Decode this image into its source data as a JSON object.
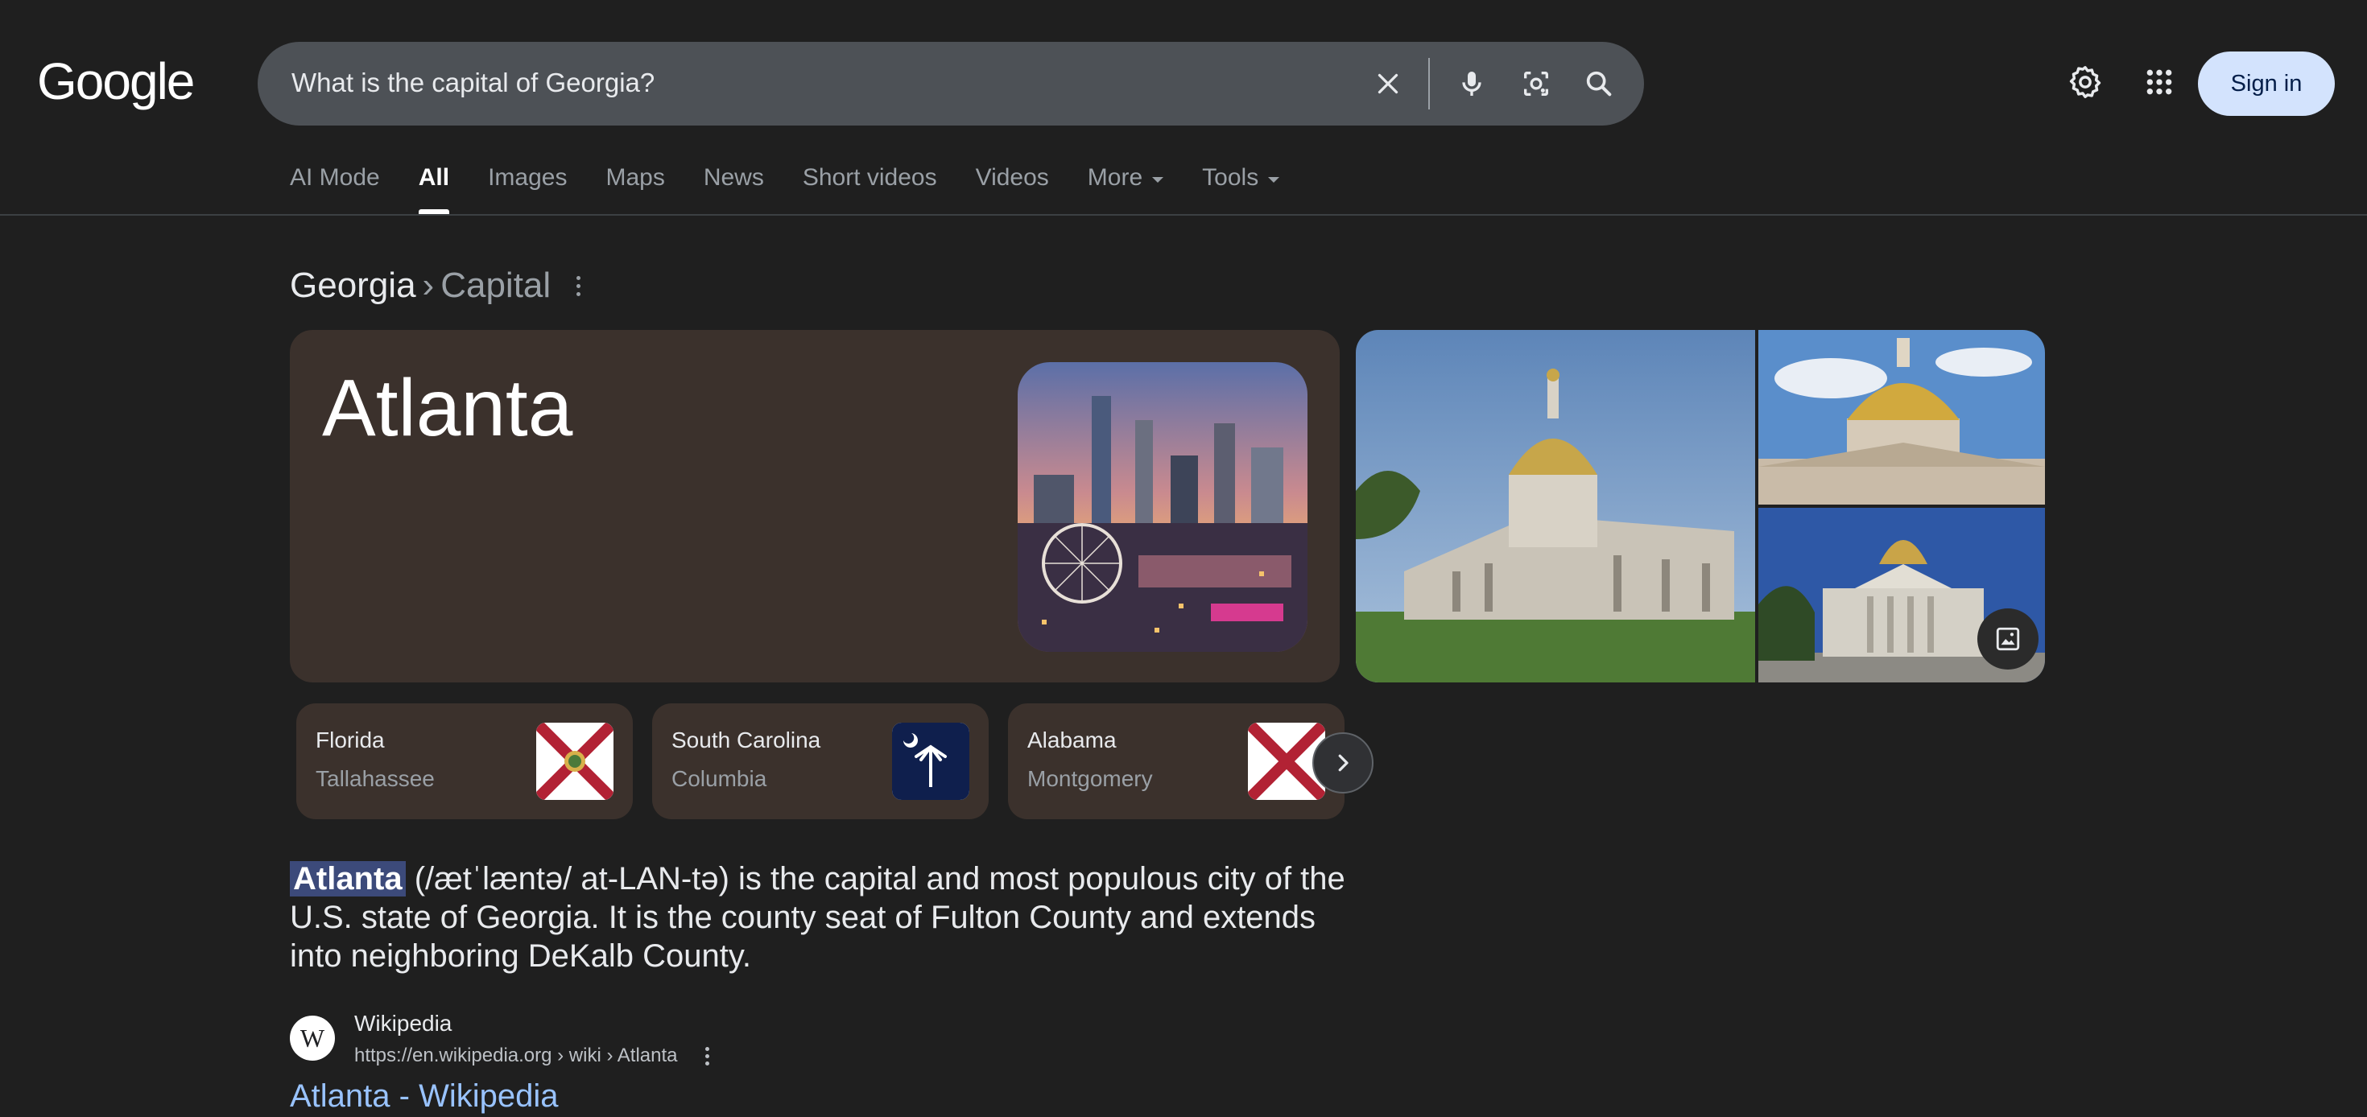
{
  "header": {
    "logo_text": "Google",
    "search_value": "What is the capital of Georgia?",
    "sign_in_label": "Sign in",
    "icons": [
      "close-icon",
      "microphone-icon",
      "lens-icon",
      "search-icon",
      "settings-icon",
      "apps-grid-icon"
    ]
  },
  "tabs": [
    {
      "label": "AI Mode"
    },
    {
      "label": "All",
      "active": true
    },
    {
      "label": "Images"
    },
    {
      "label": "Maps"
    },
    {
      "label": "News"
    },
    {
      "label": "Short videos"
    },
    {
      "label": "Videos"
    },
    {
      "label": "More",
      "dropdown": true
    },
    {
      "label": "Tools",
      "dropdown": true
    }
  ],
  "breadcrumb": {
    "topic": "Georgia",
    "separator": "›",
    "attribute": "Capital"
  },
  "answer": {
    "title": "Atlanta"
  },
  "related": [
    {
      "state": "Florida",
      "capital": "Tallahassee",
      "flag": "florida-flag"
    },
    {
      "state": "South Carolina",
      "capital": "Columbia",
      "flag": "south-carolina-flag"
    },
    {
      "state": "Alabama",
      "capital": "Montgomery",
      "flag": "alabama-flag"
    }
  ],
  "description": {
    "highlight": "Atlanta",
    "text": " (/ætˈlæntə/ at-LAN-tə) is the capital and most populous city of the U.S. state of Georgia. It is the county seat of Fulton County and extends into neighboring DeKalb County."
  },
  "source": {
    "favicon_letter": "W",
    "name": "Wikipedia",
    "url": "https://en.wikipedia.org › wiki › Atlanta",
    "link_title": "Atlanta - Wikipedia"
  },
  "colors": {
    "background": "#1f1f1f",
    "card": "#3b312c",
    "link": "#99c3ff",
    "sign_in": "#d3e3fd"
  }
}
